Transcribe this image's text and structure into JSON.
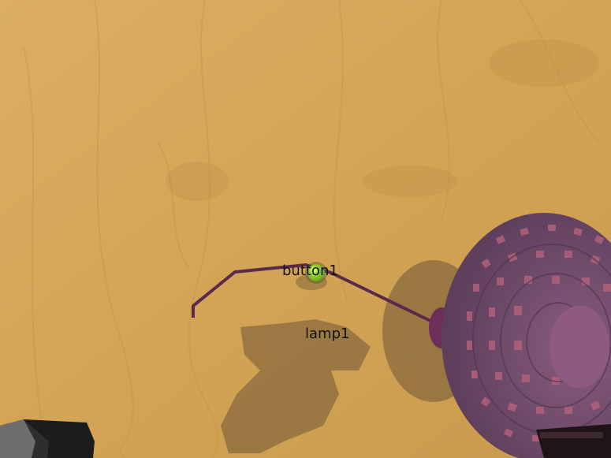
{
  "scene": {
    "objects": [
      {
        "id": "button1",
        "label": "button1",
        "kind": "button",
        "color": "#8fcf2a"
      },
      {
        "id": "lamp1",
        "label": "lamp1",
        "kind": "lamp",
        "color": "#6b3f63"
      }
    ],
    "colors": {
      "table_wood": "#d6a95b",
      "wood_grain": "#c2914a",
      "cable": "#5a2a4a",
      "lamp_shade": "#6b4a6a",
      "lamp_holes": "#c0607a",
      "shadow": "#4a3a28"
    }
  }
}
